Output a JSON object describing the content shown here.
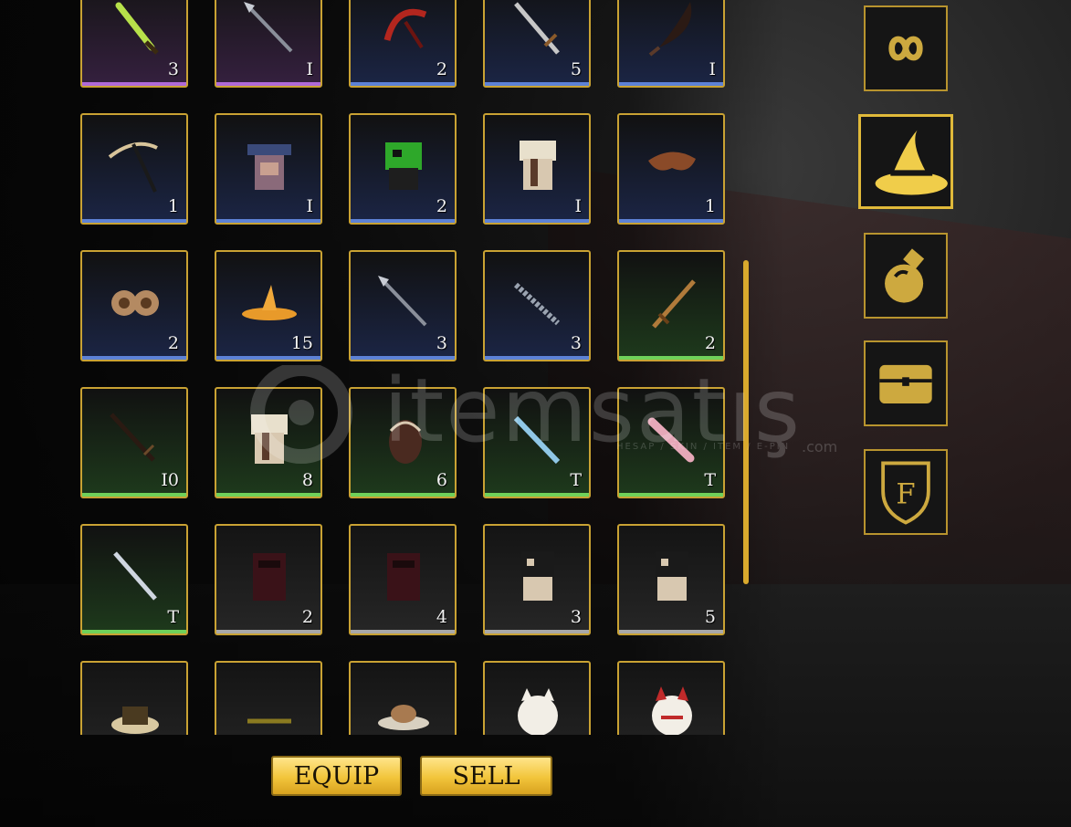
{
  "inventory": {
    "rows": [
      [
        {
          "qty": "3",
          "rarity": "purple",
          "icon": "green-dagger-icon"
        },
        {
          "qty": "I",
          "rarity": "purple",
          "icon": "spear-icon"
        },
        {
          "qty": "2",
          "rarity": "blue",
          "icon": "red-scythe-icon"
        },
        {
          "qty": "5",
          "rarity": "blue",
          "icon": "long-sword-icon"
        },
        {
          "qty": "I",
          "rarity": "blue",
          "icon": "curved-blade-icon"
        }
      ],
      [
        {
          "qty": "1",
          "rarity": "blue",
          "icon": "pickaxe-icon"
        },
        {
          "qty": "I",
          "rarity": "blue",
          "icon": "robe-outfit-icon"
        },
        {
          "qty": "2",
          "rarity": "blue",
          "icon": "green-outfit-icon"
        },
        {
          "qty": "I",
          "rarity": "blue",
          "icon": "white-outfit-icon"
        },
        {
          "qty": "1",
          "rarity": "blue",
          "icon": "mask-icon"
        }
      ],
      [
        {
          "qty": "2",
          "rarity": "blue",
          "icon": "earmuffs-icon"
        },
        {
          "qty": "15",
          "rarity": "blue",
          "icon": "straw-hat-icon"
        },
        {
          "qty": "3",
          "rarity": "blue",
          "icon": "spear-icon"
        },
        {
          "qty": "3",
          "rarity": "blue",
          "icon": "serrated-sword-icon"
        },
        {
          "qty": "2",
          "rarity": "green",
          "icon": "bronze-sword-icon"
        }
      ],
      [
        {
          "qty": "I0",
          "rarity": "green",
          "icon": "dark-sword-icon"
        },
        {
          "qty": "8",
          "rarity": "green",
          "icon": "white-outfit-icon"
        },
        {
          "qty": "6",
          "rarity": "green",
          "icon": "backpack-icon"
        },
        {
          "qty": "T",
          "rarity": "green",
          "icon": "ice-sword-icon"
        },
        {
          "qty": "T",
          "rarity": "green",
          "icon": "pink-blade-icon"
        }
      ],
      [
        {
          "qty": "T",
          "rarity": "green",
          "icon": "silver-dagger-icon"
        },
        {
          "qty": "2",
          "rarity": "gray",
          "icon": "dark-robe-icon"
        },
        {
          "qty": "4",
          "rarity": "gray",
          "icon": "dark-robe-icon"
        },
        {
          "qty": "3",
          "rarity": "gray",
          "icon": "black-outfit-icon"
        },
        {
          "qty": "5",
          "rarity": "gray",
          "icon": "black-outfit-icon"
        }
      ],
      [
        {
          "qty": "",
          "rarity": "gray",
          "icon": "cap-icon"
        },
        {
          "qty": "",
          "rarity": "gray",
          "icon": "stick-icon"
        },
        {
          "qty": "",
          "rarity": "gray",
          "icon": "straw-cap-icon"
        },
        {
          "qty": "",
          "rarity": "gray",
          "icon": "cat-mask-icon"
        },
        {
          "qty": "",
          "rarity": "gray",
          "icon": "fox-mask-icon"
        }
      ]
    ]
  },
  "actions": {
    "equip_label": "EQUIP",
    "sell_label": "SELL"
  },
  "categories": [
    {
      "icon": "infinity-icon",
      "active": false
    },
    {
      "icon": "wizard-hat-icon",
      "active": true
    },
    {
      "icon": "potion-icon",
      "active": false
    },
    {
      "icon": "chest-icon",
      "active": false
    },
    {
      "icon": "shield-f-icon",
      "active": false
    }
  ],
  "watermark": {
    "brand": "itemsatış",
    "tagline": "HESAP / SKIN / ITEM / E-PIN",
    "domain": ".com"
  },
  "colors": {
    "gold_border": "#c9a233",
    "purple": "#b06ad8",
    "blue": "#5d82d6",
    "green": "#6fd15a",
    "gray": "#a9a9a9",
    "button_gold": "#f2c53b"
  }
}
